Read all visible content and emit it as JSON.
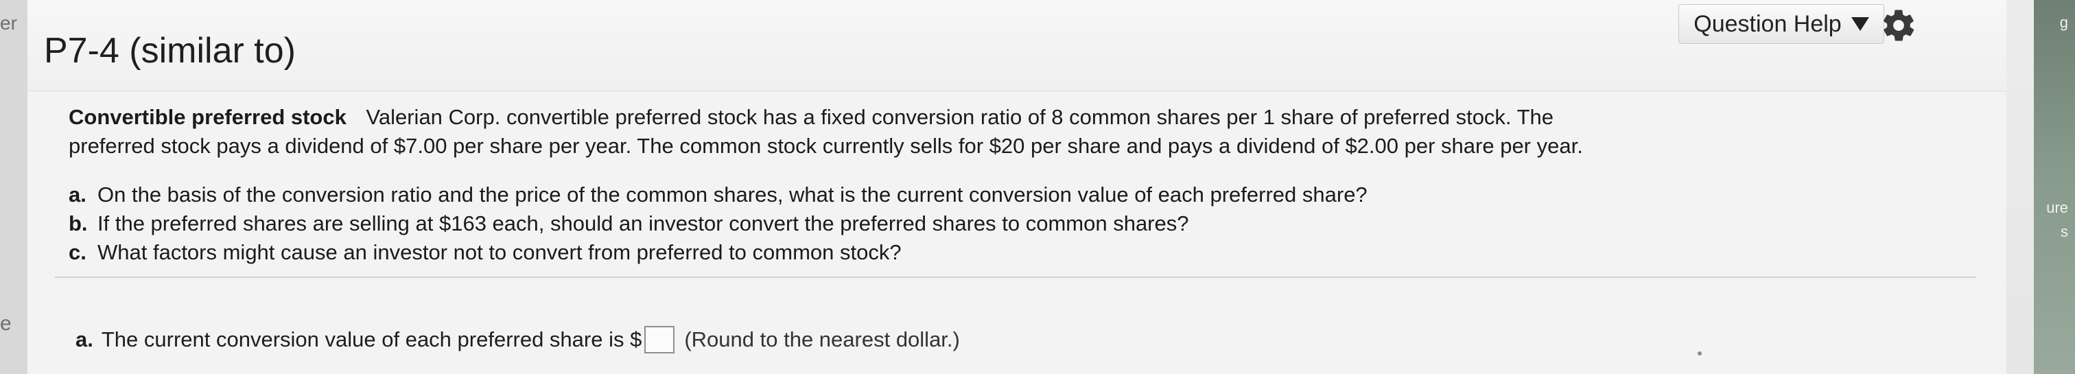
{
  "gutter": {
    "top_text": "er",
    "bottom_text": "e"
  },
  "header": {
    "title": "P7-4 (similar to)",
    "help_label": "Question Help"
  },
  "problem": {
    "lead": "Convertible preferred stock",
    "text_line_1": "Valerian Corp. convertible preferred stock has a fixed conversion ratio of 8 common shares per 1 share of preferred stock.  The",
    "text_line_2": "preferred stock pays a dividend of $7.00 per share per year.  The common stock currently sells for $20 per share and pays a dividend of $2.00 per share per year."
  },
  "questions": [
    {
      "letter": "a.",
      "text": "On the basis of the conversion ratio and the price of the common shares, what is the current conversion value of each preferred share?"
    },
    {
      "letter": "b.",
      "text": "If the preferred shares are selling at $163 each, should an investor convert the preferred shares to common shares?"
    },
    {
      "letter": "c.",
      "text": "What factors might cause an investor not to convert from preferred to common stock?"
    }
  ],
  "answer": {
    "letter": "a.",
    "text": "The current conversion value of each preferred share is $",
    "input_value": "",
    "hint": "(Round to the nearest dollar.)"
  },
  "right_strip": {
    "label_top": "g",
    "label_mid": "ure",
    "label_low": "s"
  },
  "colors": {
    "panel_bg": "#f3f3f3",
    "button_border": "#c9c9c9",
    "text_primary": "#1d1d1d",
    "right_strip": "#879a8b"
  },
  "icons": {
    "help_arrow": "triangle-down-icon",
    "settings": "gear-icon"
  }
}
